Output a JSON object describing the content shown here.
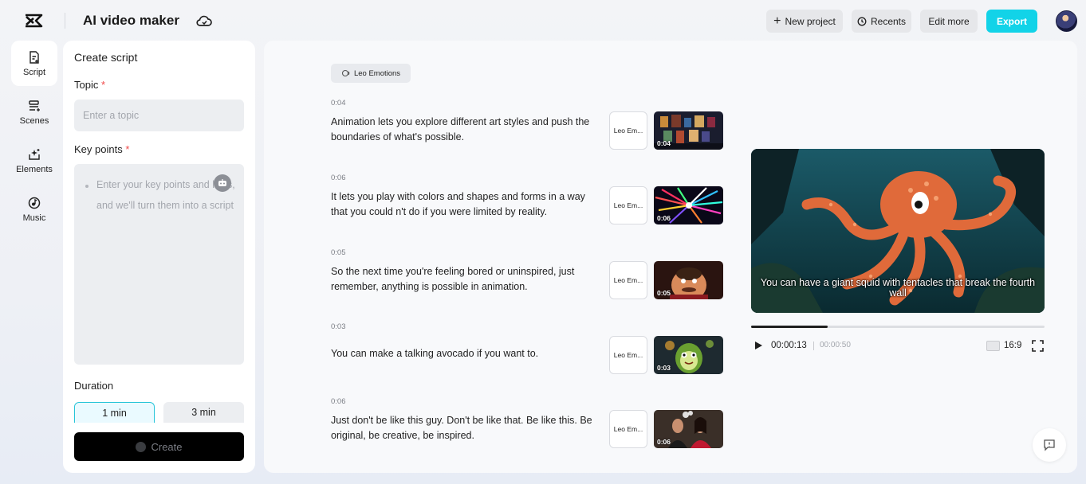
{
  "header": {
    "app_title": "AI video maker",
    "new_project": "New project",
    "recents": "Recents",
    "edit_more": "Edit more",
    "export": "Export",
    "export_color": "#12d3e8"
  },
  "rail": {
    "items": [
      {
        "label": "Script",
        "icon": "script-icon",
        "active": true
      },
      {
        "label": "Scenes",
        "icon": "scenes-icon"
      },
      {
        "label": "Elements",
        "icon": "elements-icon"
      },
      {
        "label": "Music",
        "icon": "music-icon"
      }
    ]
  },
  "script_panel": {
    "title": "Create script",
    "topic_label": "Topic",
    "topic_placeholder": "Enter a topic",
    "topic_value": "",
    "key_points_label": "Key points",
    "key_points_placeholder": "Enter your key points and links, and we'll turn them into a script",
    "duration_label": "Duration",
    "durations": [
      "1 min",
      "3 min"
    ],
    "selected_duration": "1 min",
    "create_label": "Create",
    "required_mark": "*"
  },
  "main": {
    "voice_chip": "Leo Emotions",
    "scenes": [
      {
        "time": "0:04",
        "text": "Animation lets you explore different art styles and push the boundaries of what's possible.",
        "voice": "Leo Em...",
        "duration": "0:04"
      },
      {
        "time": "0:06",
        "text": "It lets you play with colors and shapes and forms in a way that you could n't do if you were limited by reality.",
        "voice": "Leo Em...",
        "duration": "0:06"
      },
      {
        "time": "0:05",
        "text": "So the next time you're feeling bored or uninspired, just remember, anything is possible in animation.",
        "voice": "Leo Em...",
        "duration": "0:05"
      },
      {
        "time": "0:03",
        "text": "You can make a talking avocado if you want to.",
        "voice": "Leo Em...",
        "duration": "0:03"
      },
      {
        "time": "0:06",
        "text": "Just don't be like this guy. Don't be like that. Be like this. Be original, be creative, be inspired.",
        "voice": "Leo Em...",
        "duration": "0:06"
      }
    ]
  },
  "preview": {
    "caption": "You can have a giant squid with tentacles that break the fourth wall",
    "current_time": "00:00:13",
    "total_time": "00:00:50",
    "progress": 0.26,
    "aspect_ratio": "16:9"
  }
}
